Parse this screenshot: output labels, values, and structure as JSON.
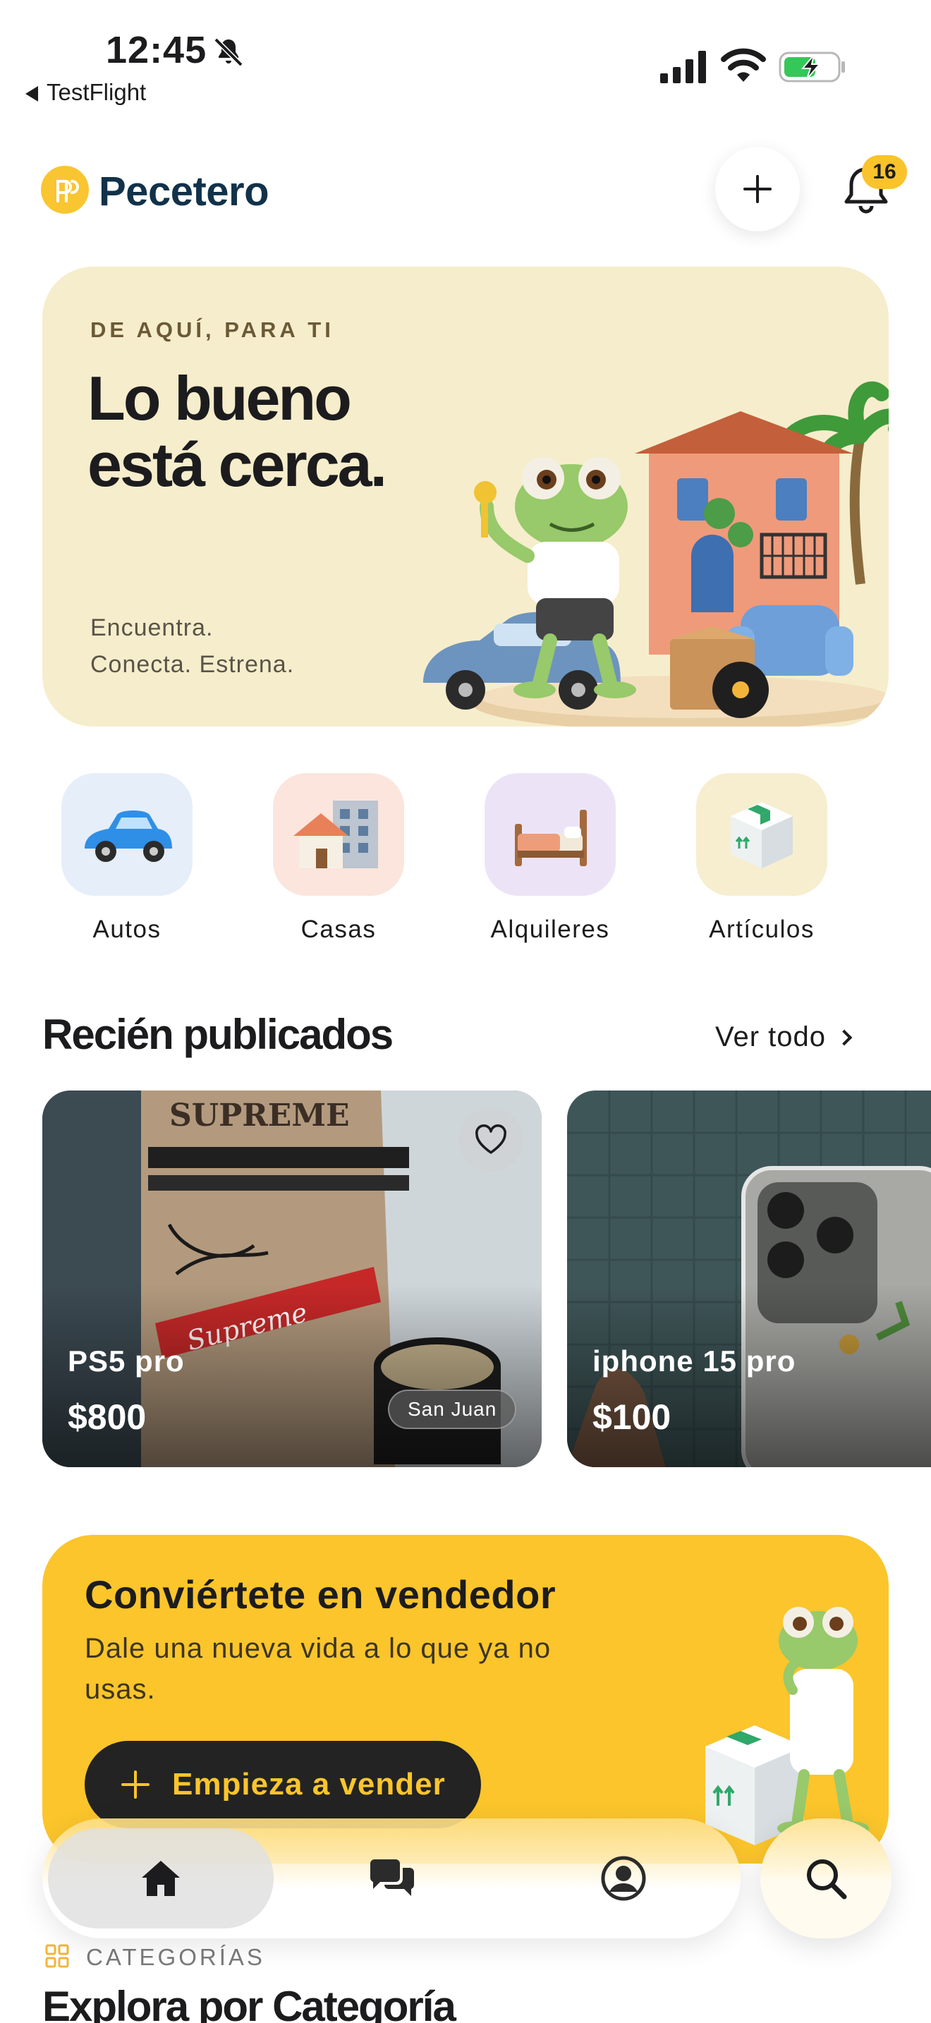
{
  "status_bar": {
    "time": "12:45",
    "back_label": "TestFlight",
    "battery_charging": true,
    "icons": [
      "bell-slash-icon",
      "cellular-signal-icon",
      "wifi-icon",
      "battery-icon"
    ]
  },
  "header": {
    "brand": "Pecetero",
    "notification_count": "16",
    "icons": [
      "logo-icon",
      "plus-icon",
      "bell-icon"
    ]
  },
  "hero": {
    "eyebrow": "DE AQUÍ, PARA TI",
    "title": "Lo bueno está cerca.",
    "subtitle_line1": "Encuentra.",
    "subtitle_line2": "Conecta. Estrena."
  },
  "categories": [
    {
      "label": "Autos",
      "icon": "car-icon",
      "tile_color": "#e6eef9"
    },
    {
      "label": "Casas",
      "icon": "houses-icon",
      "tile_color": "#fbe5dc"
    },
    {
      "label": "Alquileres",
      "icon": "bed-icon",
      "tile_color": "#ece4f6"
    },
    {
      "label": "Artículos",
      "icon": "box-icon",
      "tile_color": "#f6eecf"
    }
  ],
  "recent": {
    "title": "Recién publicados",
    "see_all": "Ver todo",
    "listings": [
      {
        "title": "PS5 pro",
        "price": "$800",
        "location": "San Juan",
        "favorite": false
      },
      {
        "title": "iphone 15 pro",
        "price": "$100"
      }
    ]
  },
  "seller_cta": {
    "title": "Conviértete en vendedor",
    "subtitle": "Dale una nueva vida a lo que ya no usas.",
    "button_label": "Empieza a vender"
  },
  "explore": {
    "eyebrow": "CATEGORÍAS",
    "title": "Explora por Categoría"
  },
  "tab_bar": {
    "tabs": [
      {
        "name": "home",
        "icon": "home-icon",
        "active": true
      },
      {
        "name": "messages",
        "icon": "chat-bubbles-icon",
        "active": false
      },
      {
        "name": "profile",
        "icon": "person-circle-icon",
        "active": false
      }
    ],
    "search_icon": "search-icon"
  },
  "colors": {
    "accent": "#fbc52b",
    "brand_text": "#12324a",
    "hero_bg": "#f6edcc",
    "button_dark": "#232323"
  }
}
